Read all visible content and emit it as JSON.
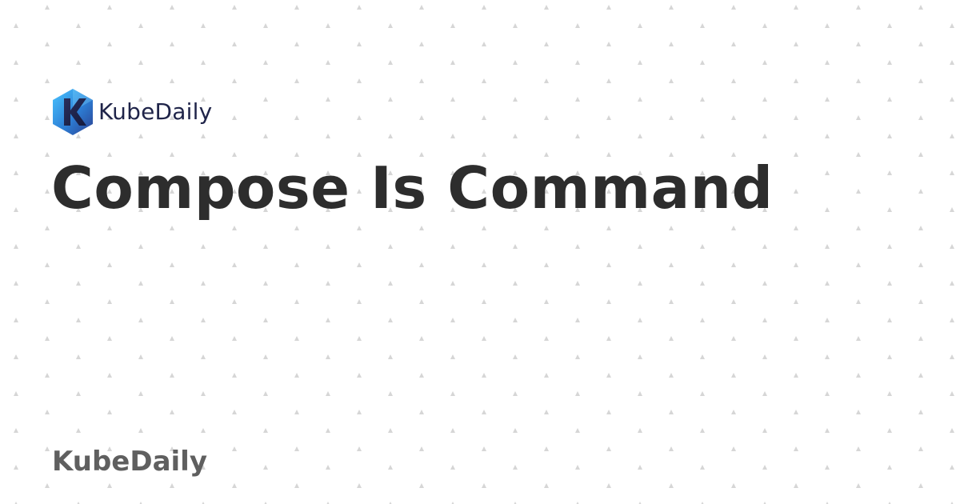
{
  "brand": {
    "logo_text": "KubeDaily",
    "logo_icon": "kubedaily-hexagon-k-icon",
    "logo_colors": {
      "gradient_start": "#3fb8ff",
      "gradient_end": "#2b3f8f",
      "letter_dark": "#1d2450"
    }
  },
  "article": {
    "title": "Compose Is Command"
  },
  "footer": {
    "brand_label": "KubeDaily"
  },
  "background": {
    "color": "#ffffff",
    "dot_color": "#d6d6d6"
  }
}
